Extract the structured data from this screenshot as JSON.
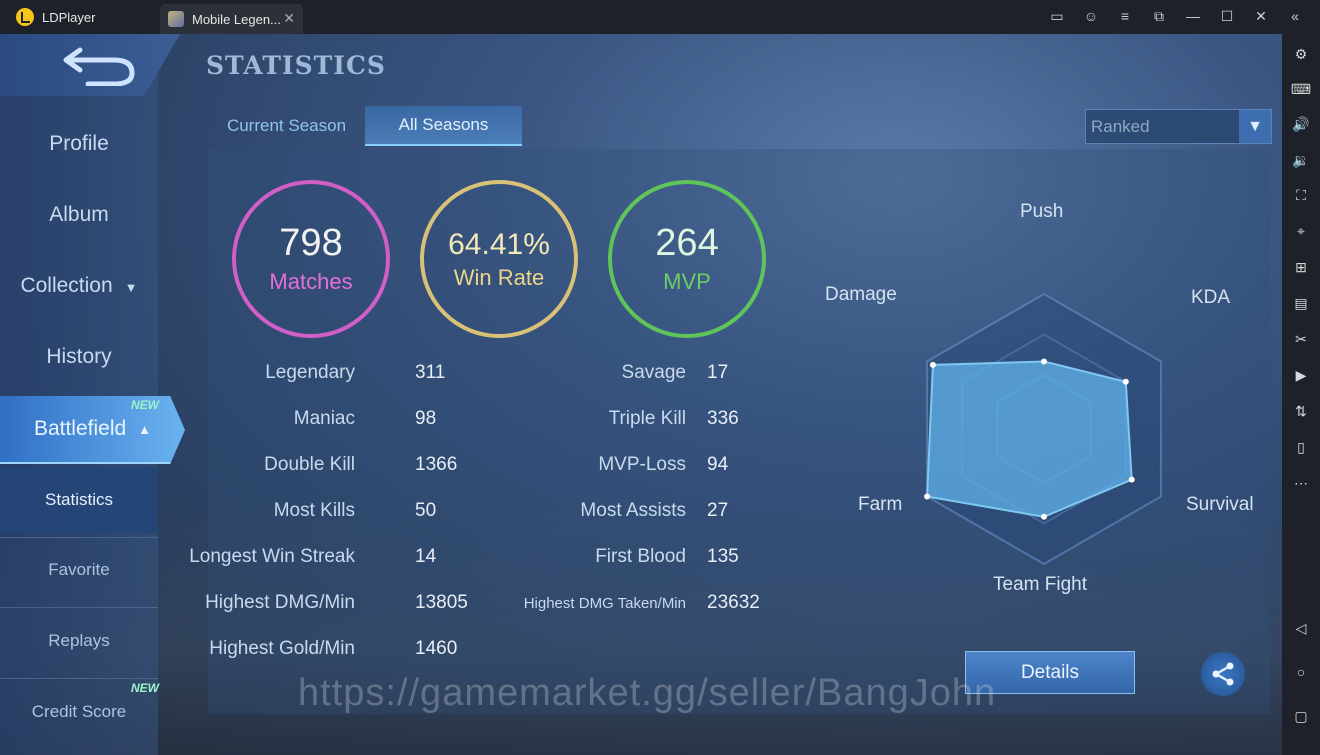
{
  "app": {
    "name": "LDPlayer",
    "tab_title": "Mobile Legen...",
    "tab_close": "✕"
  },
  "window_controls": [
    "▭",
    "☺",
    "≡",
    "⧉",
    "—",
    "☐",
    "✕",
    "«"
  ],
  "game": {
    "page_title": "STATISTICS",
    "menu": {
      "profile": "Profile",
      "album": "Album",
      "collection": "Collection",
      "history": "History",
      "battlefield": "Battlefield",
      "new_badge": "NEW",
      "sub": {
        "statistics": "Statistics",
        "favorite": "Favorite",
        "replays": "Replays",
        "credit_score": "Credit Score"
      }
    },
    "tabs": {
      "current_season": "Current Season",
      "all_seasons": "All Seasons"
    },
    "mode_select": {
      "selected": "Ranked"
    },
    "circles": {
      "matches": {
        "value": "798",
        "label": "Matches",
        "color": "#d25ec8"
      },
      "win_rate": {
        "value": "64.41%",
        "label": "Win Rate",
        "color": "#d9c278"
      },
      "mvp": {
        "value": "264",
        "label": "MVP",
        "color": "#5fc45a"
      }
    },
    "stats_left": [
      {
        "label": "Legendary",
        "value": "311"
      },
      {
        "label": "Maniac",
        "value": "98"
      },
      {
        "label": "Double Kill",
        "value": "1366"
      },
      {
        "label": "Most Kills",
        "value": "50"
      },
      {
        "label": "Longest Win Streak",
        "value": "14"
      },
      {
        "label": "Highest DMG/Min",
        "value": "13805"
      },
      {
        "label": "Highest Gold/Min",
        "value": "1460"
      }
    ],
    "stats_right": [
      {
        "label": "Savage",
        "value": "17"
      },
      {
        "label": "Triple Kill",
        "value": "336"
      },
      {
        "label": "MVP-Loss",
        "value": "94"
      },
      {
        "label": "Most Assists",
        "value": "27"
      },
      {
        "label": "First Blood",
        "value": "135"
      },
      {
        "label": "Highest DMG Taken/Min",
        "value": "23632"
      }
    ],
    "radar": {
      "push": "Push",
      "kda": "KDA",
      "survival": "Survival",
      "team_fight": "Team Fight",
      "farm": "Farm",
      "damage": "Damage"
    },
    "radar_values": {
      "push": 0.5,
      "kda": 0.7,
      "survival": 0.75,
      "team_fight": 0.65,
      "farm": 1.0,
      "damage": 0.95
    },
    "details_button": "Details",
    "share_icon": "share-icon",
    "watermark": "https://gamemarket.gg/seller/BangJohn"
  }
}
